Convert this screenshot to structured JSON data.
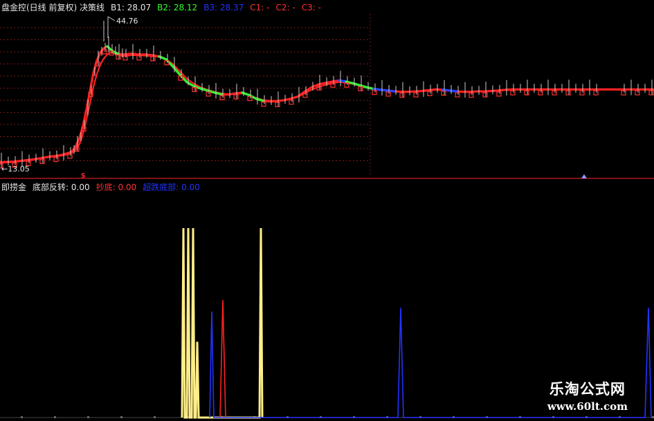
{
  "main_header": {
    "title": "盘金控(日线 前复权) 决策线",
    "title_color": "#e8e8e8",
    "values": [
      {
        "label": "B1:",
        "value": "28.07",
        "color": "#e8e8e8"
      },
      {
        "label": "B2:",
        "value": "28.12",
        "color": "#33ff33"
      },
      {
        "label": "B3:",
        "value": "28.37",
        "color": "#2233ff"
      },
      {
        "label": "C1:",
        "value": "-",
        "color": "#ff3333"
      },
      {
        "label": "C2:",
        "value": "-",
        "color": "#ff3333"
      },
      {
        "label": "C3:",
        "value": "-",
        "color": "#ff3333"
      }
    ]
  },
  "sub_header": {
    "title": "即捞金",
    "title_color": "#e8e8e8",
    "values": [
      {
        "label": "底部反转:",
        "value": "0.00",
        "color": "#e8e8e8"
      },
      {
        "label": "抄底:",
        "value": "0.00",
        "color": "#ff3333"
      },
      {
        "label": "超跌底部:",
        "value": "0.00",
        "color": "#2233ff"
      }
    ]
  },
  "watermark": {
    "title": "乐淘公式网",
    "url": "www.60lt.com"
  },
  "chart_data": [
    {
      "type": "line",
      "panel": "price",
      "annotations": {
        "high_label": "44.76",
        "low_label": "13.05",
        "marker_label": "S"
      },
      "x": [
        0,
        10,
        20,
        30,
        40,
        50,
        60,
        70,
        80,
        90,
        100,
        105,
        110,
        115,
        120,
        125,
        130,
        135,
        140,
        145,
        150,
        155,
        160,
        165,
        170,
        175,
        180,
        190,
        200,
        210,
        220,
        230,
        240,
        250,
        260,
        270,
        280,
        290,
        300,
        310,
        320,
        330,
        340,
        350,
        360,
        370,
        380,
        390,
        400,
        410,
        420,
        430,
        440,
        450,
        460,
        470,
        480,
        490,
        500,
        510,
        520,
        530,
        540,
        550,
        560,
        570,
        580,
        590,
        600,
        610,
        620,
        630,
        640,
        650,
        660,
        670,
        680,
        690,
        700,
        710,
        720,
        730,
        740,
        750,
        760,
        770,
        780,
        790,
        800,
        810,
        820,
        830,
        840,
        850,
        860,
        870,
        880,
        890,
        900,
        910,
        920,
        930,
        940,
        945
      ],
      "ylim": [
        10,
        50
      ],
      "series": [
        {
          "color": "#ff2222",
          "values": [
            13.4,
            13.5,
            13.6,
            13.8,
            14.0,
            14.2,
            14.5,
            14.8,
            15.0,
            15.3,
            15.8,
            16.3,
            17.5,
            19.5,
            22.5,
            26.5,
            31.0,
            35.5,
            38.5,
            40.5,
            41.5,
            42.0,
            41.2,
            40.6,
            40.2,
            40.1,
            40.0,
            40.2,
            40.0,
            40.0,
            39.8,
            39.5,
            38.8,
            37.0,
            35.0,
            33.2,
            32.2,
            31.6,
            31.1,
            30.6,
            30.2,
            30.1,
            30.4,
            30.6,
            30.0,
            29.1,
            28.6,
            28.4,
            28.5,
            28.7,
            29.1,
            29.6,
            30.8,
            31.9,
            32.6,
            33.0,
            33.3,
            33.6,
            33.3,
            32.9,
            32.4,
            31.9,
            31.5,
            31.3,
            31.1,
            30.9,
            30.8,
            30.8,
            30.9,
            31.0,
            31.2,
            31.4,
            31.3,
            31.1,
            30.9,
            30.8,
            30.8,
            30.9,
            30.9,
            31.0,
            31.1,
            31.3,
            31.4,
            31.4,
            31.4,
            31.4,
            31.4,
            31.4,
            31.4,
            31.4,
            31.4,
            31.4,
            31.4,
            31.4,
            31.4,
            31.4,
            31.4,
            31.4,
            31.4,
            31.4,
            31.4,
            31.4,
            31.4,
            31.4
          ]
        },
        {
          "color": "#ff2222",
          "values": [
            13.3,
            13.4,
            13.5,
            13.7,
            13.9,
            14.1,
            14.4,
            14.7,
            14.9,
            15.1,
            15.5,
            15.9,
            16.6,
            18.0,
            20.5,
            24.0,
            28.0,
            32.0,
            35.2,
            37.5,
            39.0,
            40.0,
            40.4,
            40.3,
            40.0,
            39.7,
            39.6,
            39.8,
            39.8,
            39.7,
            39.6,
            39.4,
            38.8,
            37.6,
            35.8,
            34.0,
            32.8,
            31.9,
            31.3,
            30.8,
            30.4,
            30.2,
            30.3,
            30.4,
            30.0,
            29.3,
            28.8,
            28.6,
            28.6,
            28.8,
            29.1,
            29.5,
            30.4,
            31.3,
            32.0,
            32.5,
            32.9,
            33.2,
            33.0,
            32.7,
            32.3,
            31.9,
            31.6,
            31.4,
            31.2,
            31.0,
            30.9,
            30.8,
            30.9,
            31.0,
            31.1,
            31.3,
            31.2,
            31.1,
            30.9,
            30.8,
            30.8,
            30.9,
            30.9,
            31.0,
            31.1,
            31.2,
            31.3,
            31.3,
            31.3,
            31.3,
            31.3,
            31.3,
            31.3,
            31.3,
            31.3,
            31.3,
            31.3,
            31.3,
            31.3,
            31.3,
            31.3,
            31.3,
            31.3,
            31.3,
            31.3,
            31.3,
            31.3,
            31.3
          ]
        }
      ]
    },
    {
      "type": "line",
      "panel": "indicator",
      "ylim": [
        0,
        100
      ],
      "series": [
        {
          "color": "#ffee88",
          "values_desc": "spikes",
          "spikes": [
            [
              263,
              0
            ],
            [
              265,
              100
            ],
            [
              267,
              0
            ],
            [
              270,
              0
            ],
            [
              272,
              100
            ],
            [
              274,
              0
            ],
            [
              277,
              0
            ],
            [
              279,
              100
            ],
            [
              281,
              0
            ],
            [
              283,
              0
            ],
            [
              285,
              40
            ],
            [
              287,
              0
            ],
            [
              375,
              0
            ],
            [
              377,
              100
            ],
            [
              379,
              0
            ]
          ]
        },
        {
          "color": "#ff2222",
          "spikes": [
            [
              318,
              0
            ],
            [
              322,
              62
            ],
            [
              326,
              0
            ]
          ]
        },
        {
          "color": "#2233ff",
          "spikes": [
            [
              303,
              0
            ],
            [
              306,
              56
            ],
            [
              309,
              0
            ],
            [
              575,
              0
            ],
            [
              579,
              58
            ],
            [
              583,
              0
            ],
            [
              932,
              0
            ],
            [
              937,
              58
            ],
            [
              941,
              0
            ]
          ]
        }
      ]
    }
  ]
}
